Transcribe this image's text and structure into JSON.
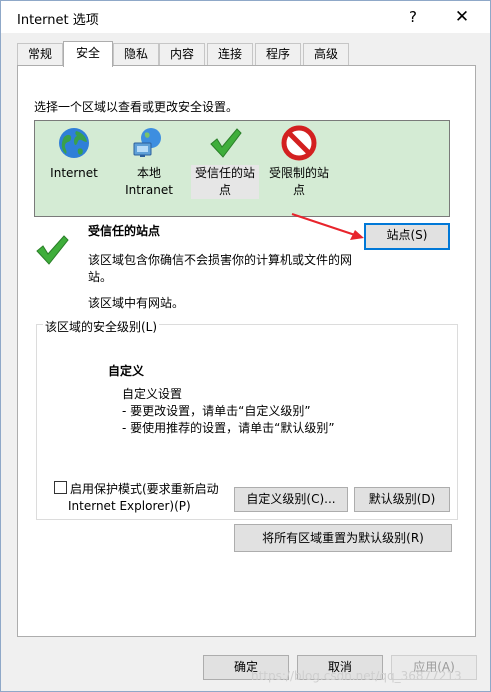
{
  "window": {
    "title": "Internet 选项",
    "help_label": "?",
    "close_label": "✕"
  },
  "tabs": [
    {
      "label": "常规",
      "active": false
    },
    {
      "label": "安全",
      "active": true
    },
    {
      "label": "隐私",
      "active": false
    },
    {
      "label": "内容",
      "active": false
    },
    {
      "label": "连接",
      "active": false
    },
    {
      "label": "程序",
      "active": false
    },
    {
      "label": "高级",
      "active": false
    }
  ],
  "security": {
    "zones_label": "选择一个区域以查看或更改安全设置。",
    "zones": [
      {
        "label_line1": "Internet",
        "label_line2": "",
        "icon": "globe-icon"
      },
      {
        "label_line1": "本地",
        "label_line2": "Intranet",
        "icon": "local-intranet-icon"
      },
      {
        "label_line1": "受信任的站",
        "label_line2": "点",
        "icon": "green-check-icon",
        "selected": true
      },
      {
        "label_line1": "受限制的站",
        "label_line2": "点",
        "icon": "restricted-icon"
      }
    ],
    "selected_zone": {
      "title": "受信任的站点",
      "description": "该区域包含你确信不会损害你的计算机或文件的网站。",
      "status": "该区域中有网站。",
      "sites_button": "站点(S)"
    },
    "level_group": {
      "label": "该区域的安全级别(L)",
      "level_name": "自定义",
      "level_lines": [
        "自定义设置",
        "- 要更改设置，请单击“自定义级别”",
        "- 要使用推荐的设置，请单击“默认级别”"
      ],
      "protected_mode_line1": "启用保护模式(要求重新启动",
      "protected_mode_line2": "Internet Explorer)(P)",
      "protected_mode_checked": false,
      "custom_level_button": "自定义级别(C)...",
      "default_level_button": "默认级别(D)"
    },
    "reset_all_button": "将所有区域重置为默认级别(R)"
  },
  "footer": {
    "ok_label": "确定",
    "cancel_label": "取消",
    "apply_label": "应用(A)"
  },
  "watermark": "https://blog.csdn.net/qq_36877213",
  "colors": {
    "zone_list_bg": "#d4ebd4",
    "arrow": "#e8242c",
    "focus_border": "#0078d7"
  }
}
